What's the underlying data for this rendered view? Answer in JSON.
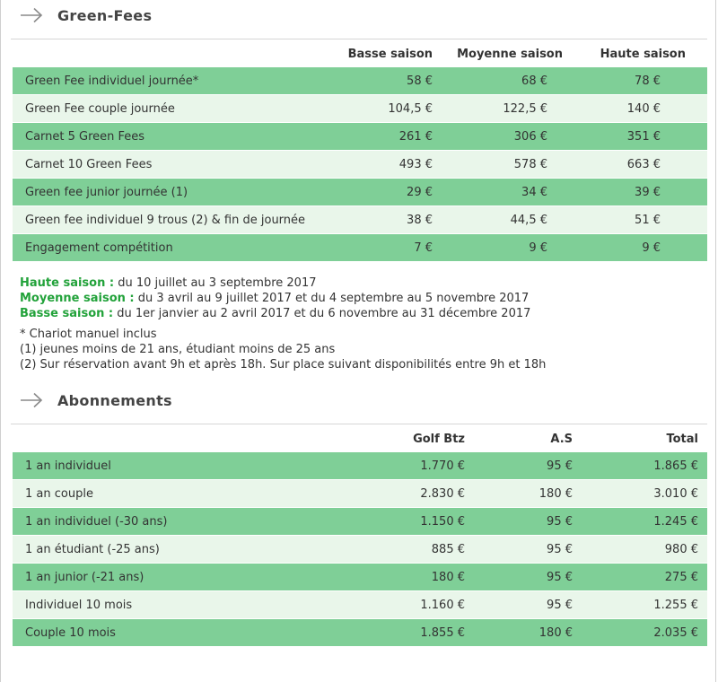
{
  "greenfees": {
    "title": "Green-Fees",
    "headers": [
      "Basse saison",
      "Moyenne saison",
      "Haute saison"
    ],
    "rows": [
      {
        "label": "Green Fee individuel journée*",
        "values": [
          "58 €",
          "68 €",
          "78 €"
        ]
      },
      {
        "label": "Green Fee couple journée",
        "values": [
          "104,5 €",
          "122,5 €",
          "140 €"
        ]
      },
      {
        "label": "Carnet 5 Green Fees",
        "values": [
          "261 €",
          "306 €",
          "351 €"
        ]
      },
      {
        "label": "Carnet 10 Green Fees",
        "values": [
          "493 €",
          "578 €",
          "663 €"
        ]
      },
      {
        "label": "Green fee junior journée (1)",
        "values": [
          "29 €",
          "34 €",
          "39 €"
        ]
      },
      {
        "label": "Green fee individuel 9 trous (2) & fin de journée",
        "values": [
          "38 €",
          "44,5 €",
          "51 €"
        ]
      },
      {
        "label": "Engagement compétition",
        "values": [
          "7 €",
          "9 €",
          "9 €"
        ]
      }
    ]
  },
  "seasons": [
    {
      "name": "Haute saison :",
      "text": " du 10 juillet au 3 septembre 2017"
    },
    {
      "name": "Moyenne saison :",
      "text": " du 3 avril au 9 juillet 2017 et du 4 septembre au 5 novembre 2017"
    },
    {
      "name": "Basse saison :",
      "text": " du 1er janvier au 2 avril 2017 et du 6 novembre au 31 décembre 2017"
    }
  ],
  "footnotes": [
    "* Chariot manuel inclus",
    "(1) jeunes moins de 21 ans, étudiant moins de 25 ans",
    "(2) Sur réservation avant 9h et après 18h. Sur place suivant disponibilités entre 9h et 18h"
  ],
  "abonnements": {
    "title": "Abonnements",
    "headers": [
      "Golf Btz",
      "A.S",
      "Total"
    ],
    "rows": [
      {
        "label": "1 an individuel",
        "values": [
          "1.770 €",
          "95 €",
          "1.865 €"
        ]
      },
      {
        "label": "1 an couple",
        "values": [
          "2.830 €",
          "180 €",
          "3.010 €"
        ]
      },
      {
        "label": "1 an individuel (-30 ans)",
        "values": [
          "1.150 €",
          "95 €",
          "1.245 €"
        ]
      },
      {
        "label": "1 an étudiant (-25 ans)",
        "values": [
          "885 €",
          "95 €",
          "980 €"
        ]
      },
      {
        "label": "1 an junior (-21 ans)",
        "values": [
          "180 €",
          "95 €",
          "275 €"
        ]
      },
      {
        "label": " Individuel 10 mois",
        "values": [
          "1.160 €",
          "95 €",
          "1.255 €"
        ]
      },
      {
        "label": " Couple 10 mois",
        "values": [
          "1.855 €",
          "180 €",
          "2.035 €"
        ]
      }
    ]
  },
  "colors": {
    "row_dark": "#7fcf97",
    "row_light": "#e9f6ea",
    "season_label": "#22a23a"
  }
}
